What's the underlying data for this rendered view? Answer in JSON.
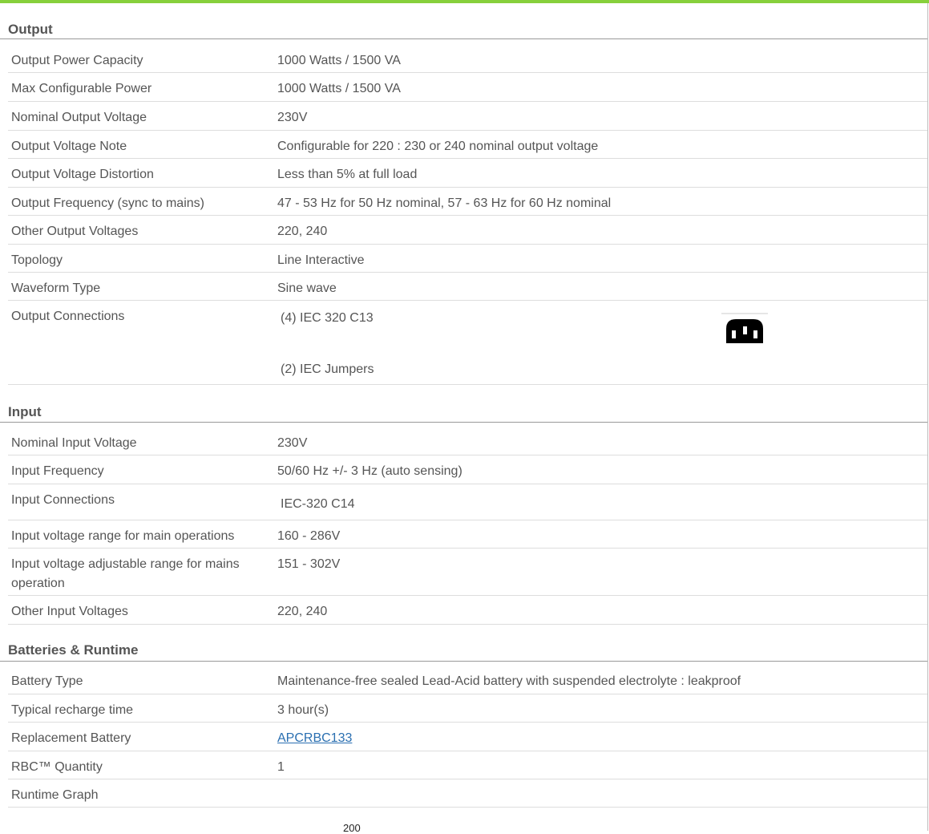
{
  "colors": {
    "accent": "#87d03c",
    "link": "#2a6fb1",
    "text": "#555555"
  },
  "sections": {
    "output": {
      "title": "Output",
      "rows": [
        {
          "label": "Output Power Capacity",
          "value": "1000 Watts / 1500 VA"
        },
        {
          "label": "Max Configurable Power",
          "value": "1000 Watts / 1500 VA"
        },
        {
          "label": "Nominal Output Voltage",
          "value": "230V"
        },
        {
          "label": "Output Voltage Note",
          "value": "Configurable for 220 : 230 or 240 nominal output voltage"
        },
        {
          "label": "Output Voltage Distortion",
          "value": "Less than 5% at full load"
        },
        {
          "label": "Output Frequency (sync to mains)",
          "value": "47 - 53 Hz for 50 Hz nominal, 57 - 63 Hz for 60 Hz nominal"
        },
        {
          "label": "Other Output Voltages",
          "value": "220, 240"
        },
        {
          "label": "Topology",
          "value": "Line Interactive"
        },
        {
          "label": "Waveform Type",
          "value": "Sine wave"
        }
      ],
      "connections": {
        "label": "Output Connections",
        "value_1": "(4) IEC 320 C13",
        "value_2": "(2) IEC Jumpers",
        "icon": "iec-c13-outlet-icon"
      }
    },
    "input": {
      "title": "Input",
      "rows": [
        {
          "label": "Nominal Input Voltage",
          "value": "230V"
        },
        {
          "label": "Input Frequency",
          "value": "50/60 Hz +/- 3 Hz (auto sensing)"
        },
        {
          "label": "Input Connections",
          "value": "IEC-320 C14"
        },
        {
          "label": "Input voltage range for main operations",
          "value": "160 - 286V"
        },
        {
          "label": "Input voltage adjustable range for mains operation",
          "value": "151 - 302V"
        },
        {
          "label": "Other Input Voltages",
          "value": "220, 240"
        }
      ]
    },
    "batteries": {
      "title": "Batteries & Runtime",
      "rows": [
        {
          "label": "Battery Type",
          "value": "Maintenance-free sealed Lead-Acid battery with suspended electrolyte : leakproof"
        },
        {
          "label": "Typical recharge time",
          "value": "3 hour(s)"
        },
        {
          "label": "Replacement Battery",
          "value": "APCRBC133"
        },
        {
          "label": "RBC™ Quantity",
          "value": "1"
        },
        {
          "label": "Runtime Graph",
          "value": ""
        }
      ],
      "graph_axis_top": "200"
    }
  }
}
